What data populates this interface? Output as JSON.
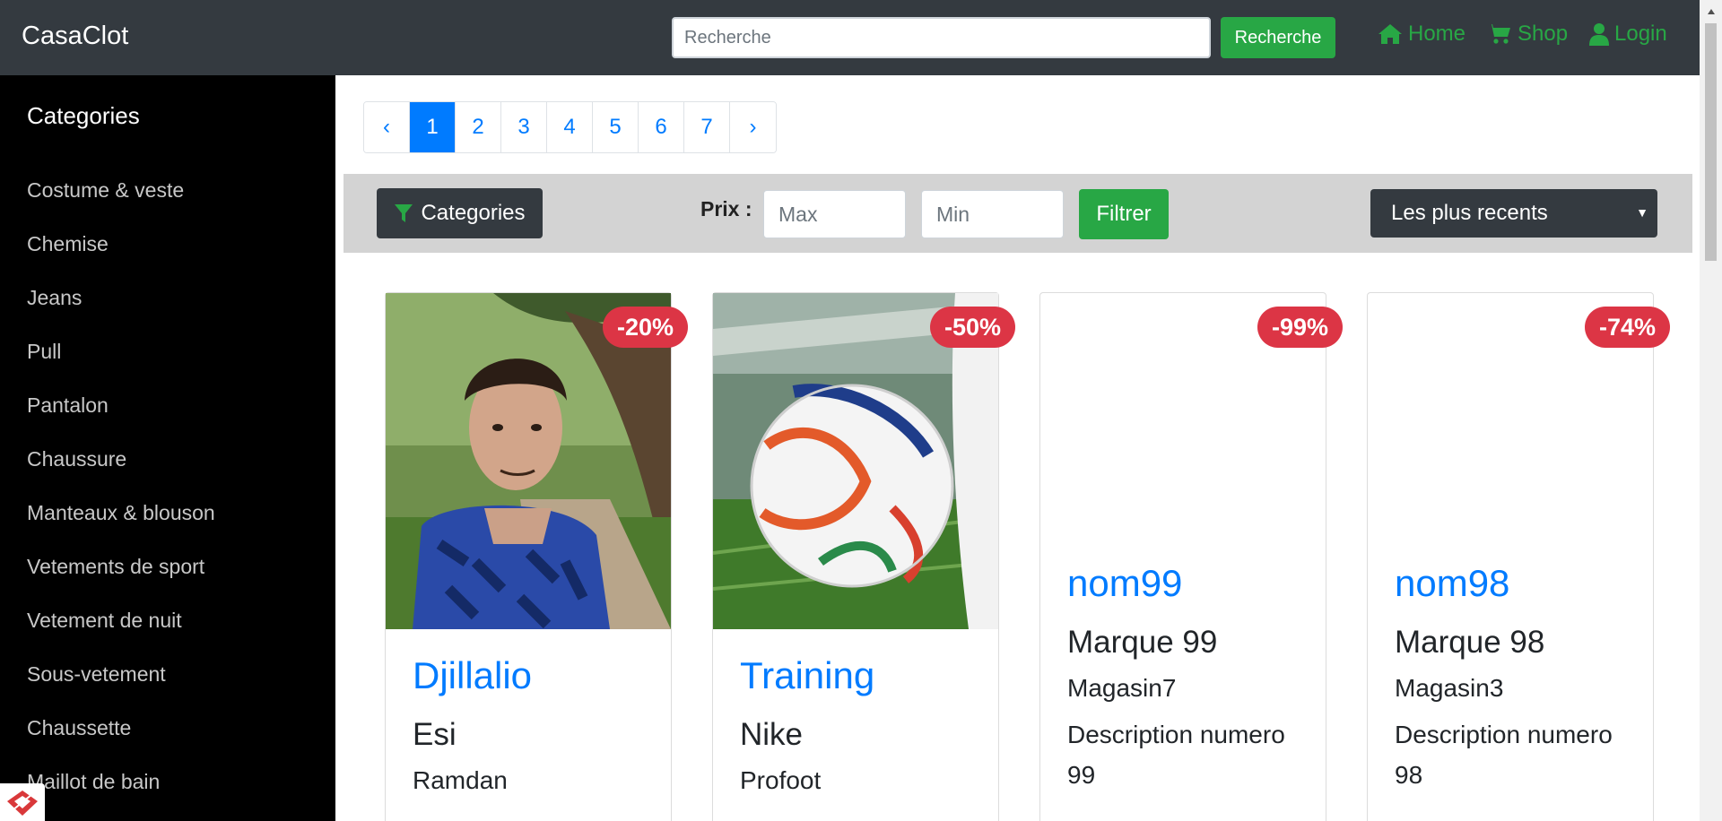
{
  "navbar": {
    "brand": "CasaClot",
    "search_placeholder": "Recherche",
    "search_button": "Recherche",
    "links": [
      {
        "label": "Home",
        "icon": "home-icon"
      },
      {
        "label": "Shop",
        "icon": "cart-icon"
      },
      {
        "label": "Login",
        "icon": "user-icon"
      }
    ]
  },
  "sidebar": {
    "title": "Categories",
    "items": [
      "Costume & veste",
      "Chemise",
      "Jeans",
      "Pull",
      "Pantalon",
      "Chaussure",
      "Manteaux & blouson",
      "Vetements de sport",
      "Vetement de nuit",
      "Sous-vetement",
      "Chaussette",
      "Maillot de bain"
    ]
  },
  "pagination": {
    "prev": "‹",
    "pages": [
      "1",
      "2",
      "3",
      "4",
      "5",
      "6",
      "7"
    ],
    "active": "1",
    "next": "›"
  },
  "filters": {
    "categories_button": "Categories",
    "price_label": "Prix :",
    "max_placeholder": "Max",
    "min_placeholder": "Min",
    "filter_button": "Filtrer",
    "sort_selected": "Les plus recents"
  },
  "products": [
    {
      "discount": "-20%",
      "name": "Djillalio",
      "brand": "Esi",
      "store": "Ramdan",
      "description": ""
    },
    {
      "discount": "-50%",
      "name": "Training",
      "brand": "Nike",
      "store": "Profoot",
      "description": ""
    },
    {
      "discount": "-99%",
      "name": "nom99",
      "brand": "Marque 99",
      "store": "Magasin7",
      "description": "Description numero 99"
    },
    {
      "discount": "-74%",
      "name": "nom98",
      "brand": "Marque 98",
      "store": "Magasin3",
      "description": "Description numero 98"
    }
  ],
  "colors": {
    "navbar_bg": "#343a40",
    "accent_green": "#28a745",
    "link_blue": "#007bff",
    "badge_red": "#dc3545"
  }
}
